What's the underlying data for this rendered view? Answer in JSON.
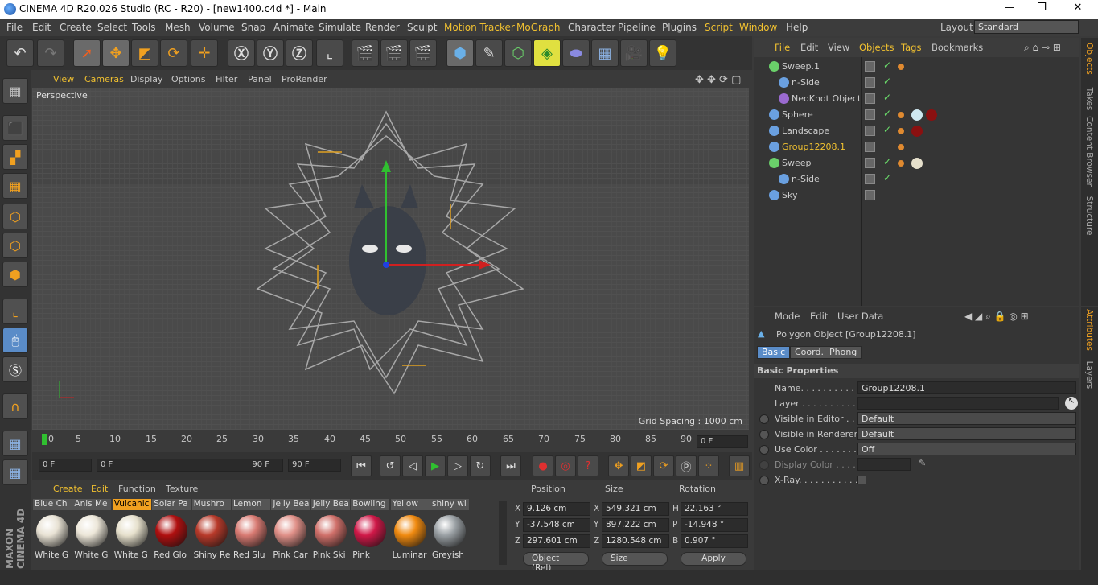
{
  "window": {
    "title": "CINEMA 4D R20.026 Studio (RC - R20) - [new1400.c4d *] - Main",
    "min": "—",
    "max": "❐",
    "close": "✕"
  },
  "menus": [
    "File",
    "Edit",
    "Create",
    "Select",
    "Tools",
    "Mesh",
    "Volume",
    "Snap",
    "Animate",
    "Simulate",
    "Render",
    "Sculpt",
    "Motion Tracker",
    "MoGraph",
    "Character",
    "Pipeline",
    "Plugins",
    "Script",
    "Window",
    "Help"
  ],
  "layout": {
    "label": "Layout:",
    "value": "Standard"
  },
  "viewport": {
    "menus": [
      "View",
      "Cameras",
      "Display",
      "Options",
      "Filter",
      "Panel",
      "ProRender"
    ],
    "camera": "Perspective",
    "grid_spacing": "Grid Spacing : 1000 cm"
  },
  "timeline": {
    "ticks": [
      "0",
      "5",
      "10",
      "15",
      "20",
      "25",
      "30",
      "35",
      "40",
      "45",
      "50",
      "55",
      "60",
      "65",
      "70",
      "75",
      "80",
      "85",
      "90"
    ],
    "current": "0 F"
  },
  "transport": {
    "start": "0 F",
    "range_start": "0 F",
    "range_end": "90 F",
    "end": "90 F"
  },
  "materials": {
    "menus": [
      "Create",
      "Edit",
      "Function",
      "Texture"
    ],
    "items": [
      {
        "tab": "Blue Ch",
        "label": "White G",
        "color": "#e8e2d4"
      },
      {
        "tab": "Anis Me",
        "label": "White G",
        "color": "#ece6d8"
      },
      {
        "tab": "Vulcanic",
        "label": "White G",
        "color": "#e6e0cc",
        "active": true
      },
      {
        "tab": "Solar Pa",
        "label": "Red Glo",
        "color": "#b01010"
      },
      {
        "tab": "Mushro",
        "label": "Shiny Re",
        "color": "#b83a2a"
      },
      {
        "tab": "Lemon",
        "label": "Red Slu",
        "color": "#d87a72"
      },
      {
        "tab": "Jelly Bea",
        "label": "Pink Car",
        "color": "#e09088"
      },
      {
        "tab": "Jelly Bea",
        "label": "Pink Ski",
        "color": "#d0706a"
      },
      {
        "tab": "Bowling",
        "label": "Pink",
        "color": "#d01848"
      },
      {
        "tab": "Yellow",
        "label": "Luminar",
        "color": "#f08a10"
      },
      {
        "tab": "shiny wl",
        "label": "Greyish",
        "color": "#9aa0a4"
      }
    ]
  },
  "coords": {
    "headers": [
      "Position",
      "Size",
      "Rotation"
    ],
    "rows": [
      {
        "a": "X",
        "av": "9.126 cm",
        "b": "X",
        "bv": "549.321 cm",
        "c": "H",
        "cv": "22.163 °"
      },
      {
        "a": "Y",
        "av": "-37.548 cm",
        "b": "Y",
        "bv": "897.222 cm",
        "c": "P",
        "cv": "-14.948 °"
      },
      {
        "a": "Z",
        "av": "297.601 cm",
        "b": "Z",
        "bv": "1280.548 cm",
        "c": "B",
        "cv": "0.907 °"
      }
    ],
    "mode": "Object (Rel)",
    "size_mode": "Size",
    "apply": "Apply"
  },
  "objects": {
    "menus": [
      "File",
      "Edit",
      "View",
      "Objects",
      "Tags",
      "Bookmarks"
    ],
    "rows": [
      {
        "name": "Sweep.1",
        "color": "#6ad06a"
      },
      {
        "name": "n-Side",
        "color": "#6aa0e0"
      },
      {
        "name": "NeoKnot Object",
        "color": "#9a6ad0"
      },
      {
        "name": "Sphere",
        "color": "#6aa0e0"
      },
      {
        "name": "Landscape",
        "color": "#6aa0e0"
      },
      {
        "name": "Group12208.1",
        "color": "#6aa0e0",
        "selected": true
      },
      {
        "name": "Sweep",
        "color": "#6ad06a"
      },
      {
        "name": "n-Side",
        "color": "#6aa0e0"
      },
      {
        "name": "Sky",
        "color": "#6aa0e0"
      }
    ]
  },
  "sidetabs_top": [
    "Objects",
    "Takes",
    "Content Browser",
    "Structure"
  ],
  "sidetabs_bottom": [
    "Attributes",
    "Layers"
  ],
  "attributes": {
    "menus": [
      "Mode",
      "Edit",
      "User Data"
    ],
    "object": "Polygon Object [Group12208.1]",
    "tabs": [
      "Basic",
      "Coord.",
      "Phong"
    ],
    "section": "Basic Properties",
    "props": [
      {
        "label": "Name. . . . . . . . . . . .",
        "value": "Group12208.1"
      },
      {
        "label": "Layer . . . . . . . . . . . .",
        "value": ""
      },
      {
        "label": "Visible in Editor . . .",
        "value": "Default"
      },
      {
        "label": "Visible in Renderer",
        "value": "Default"
      },
      {
        "label": "Use Color . . . . . . .",
        "value": "Off"
      },
      {
        "label": "Display Color . . . .",
        "value": ""
      },
      {
        "label": "X-Ray. . . . . . . . . . .",
        "value": ""
      }
    ]
  },
  "maxon": "MAXON CINEMA 4D"
}
